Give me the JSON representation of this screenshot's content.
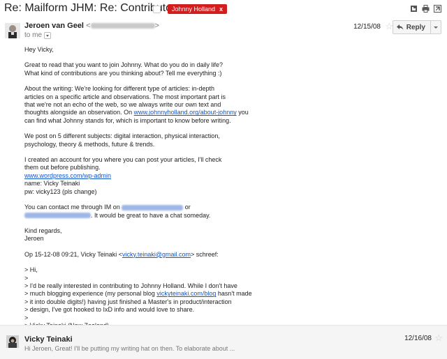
{
  "thread": {
    "subject": "Re: Mailform JHM: Re: Contributors",
    "label": "Johnny Holland",
    "label_remove": "x"
  },
  "message1": {
    "sender_name": "Jeroen van Geel",
    "sender_email_open": "<",
    "sender_email_close": ">",
    "to": "to me",
    "date": "12/15/08",
    "reply_label": "Reply",
    "greeting": "Hey Vicky,",
    "para1": [
      "Great to read that you want to join Johnny. What do you do in daily life?",
      "What kind of contributions are you thinking about? Tell me everything :)"
    ],
    "para2_lines": [
      "About the writing: We're looking for different type of articles: in-depth",
      "articles on a specific article and observations. The most important part is",
      "that we're not an echo of the web, so we always write our own text and"
    ],
    "para2_line4_before": "thoughts alongside an observation. On ",
    "para2_link": "www.johnnyholland.org/about-johnny",
    "para2_line4_after": " you",
    "para2_line5": "can find what Johnny stands for, which is important to know before writing.",
    "para3": [
      "We post on 5 different subjects: digital interaction, physical interaction,",
      "psychology, theory & methods, future & trends."
    ],
    "para4_lines": [
      "I created an account for you where you can post your articles, I'll check",
      "them out before publishing."
    ],
    "para4_link": "www.wordpress.com/wp-admin",
    "para4_name": "name: Vicky Teinaki",
    "para4_pw": "pw: vicky123 (pls change)",
    "para5_before": "You can contact me through IM on ",
    "para5_mid": " or",
    "para5_after": ". It would be great to have a chat someday.",
    "signoff": [
      "Kind regards,",
      "Jeroen"
    ],
    "quote_head_before": "Op 15-12-08 09:21, Vicky Teinaki <",
    "quote_head_link": "vicky.teinaki@gmail.com",
    "quote_head_after": "> schreef:",
    "quote_lines_a": [
      "> Hi,",
      ">",
      "> I'd be really interested in contributing to Johnny Holland. While I don't have"
    ],
    "quote_line_link_before": "> much blogging experience (my personal blog ",
    "quote_line_link": "vickyteinaki.com/blog",
    "quote_line_link_after": " hasn't made",
    "quote_lines_b": [
      "> it into double digits!) having just finished a Master's in product/interaction",
      "> design, I've got hooked to IxD info and would love to share.",
      ">",
      "> Vicky Teinaki (New Zealand)",
      ">"
    ]
  },
  "message2": {
    "sender_name": "Vicky Teinaki",
    "snippet": "Hi Jeroen, Great! I'll be putting my writing hat on then. To elaborate about ...",
    "date": "12/16/08"
  },
  "icons": {
    "top": [
      "new-window-icon",
      "print-icon",
      "expand-all-icon"
    ],
    "star": "☆",
    "reply": "reply-arrow-icon"
  },
  "colors": {
    "label_red": "#d11e1e",
    "link_blue": "#1155cc"
  }
}
